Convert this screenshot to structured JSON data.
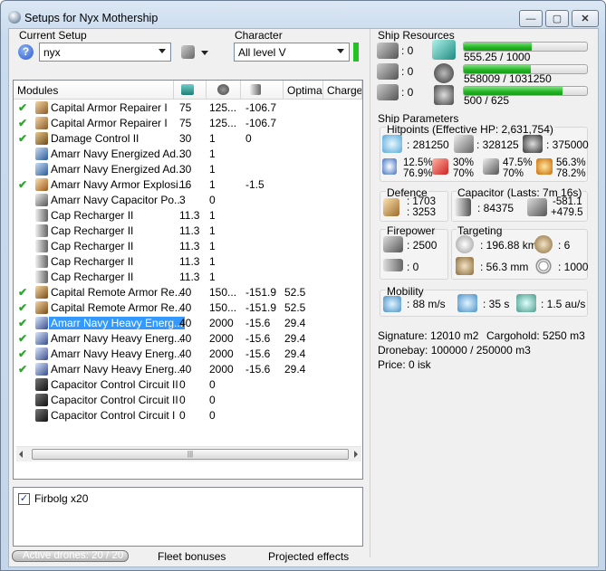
{
  "window": {
    "title": "Setups for Nyx Mothership"
  },
  "setup": {
    "label": "Current Setup",
    "value": "nyx"
  },
  "character": {
    "label": "Character",
    "value": "All level V"
  },
  "modules": {
    "headers": [
      "Modules",
      "",
      "",
      "",
      "Optimal",
      "Charges"
    ],
    "rows": [
      {
        "checked": true,
        "name": "Capital Armor Repairer I",
        "c1": "75",
        "c2": "125...",
        "c3": "-106.7",
        "opt": "",
        "icon": "armor-repairer-icon"
      },
      {
        "checked": true,
        "name": "Capital Armor Repairer I",
        "c1": "75",
        "c2": "125...",
        "c3": "-106.7",
        "opt": "",
        "icon": "armor-repairer-icon"
      },
      {
        "checked": true,
        "name": "Damage Control II",
        "c1": "30",
        "c2": "1",
        "c3": "0",
        "opt": "",
        "icon": "damage-control-icon"
      },
      {
        "checked": false,
        "name": "Amarr Navy Energized Ad...",
        "c1": "30",
        "c2": "1",
        "c3": "",
        "opt": "",
        "icon": "energized-plating-icon"
      },
      {
        "checked": false,
        "name": "Amarr Navy Energized Ad...",
        "c1": "30",
        "c2": "1",
        "c3": "",
        "opt": "",
        "icon": "energized-plating-icon"
      },
      {
        "checked": true,
        "name": "Amarr Navy Armor Explosi...",
        "c1": "16",
        "c2": "1",
        "c3": "-1.5",
        "opt": "",
        "icon": "armor-hardener-icon"
      },
      {
        "checked": false,
        "name": "Amarr Navy Capacitor Po...",
        "c1": "3",
        "c2": "0",
        "c3": "",
        "opt": "",
        "icon": "capacitor-power-relay-icon"
      },
      {
        "checked": false,
        "name": "Cap Recharger II",
        "c1": "11.3",
        "c2": "1",
        "c3": "",
        "opt": "",
        "icon": "cap-recharger-icon"
      },
      {
        "checked": false,
        "name": "Cap Recharger II",
        "c1": "11.3",
        "c2": "1",
        "c3": "",
        "opt": "",
        "icon": "cap-recharger-icon"
      },
      {
        "checked": false,
        "name": "Cap Recharger II",
        "c1": "11.3",
        "c2": "1",
        "c3": "",
        "opt": "",
        "icon": "cap-recharger-icon"
      },
      {
        "checked": false,
        "name": "Cap Recharger II",
        "c1": "11.3",
        "c2": "1",
        "c3": "",
        "opt": "",
        "icon": "cap-recharger-icon"
      },
      {
        "checked": false,
        "name": "Cap Recharger II",
        "c1": "11.3",
        "c2": "1",
        "c3": "",
        "opt": "",
        "icon": "cap-recharger-icon"
      },
      {
        "checked": true,
        "name": "Capital Remote Armor Re...",
        "c1": "40",
        "c2": "150...",
        "c3": "-151.9",
        "opt": "52.5",
        "icon": "remote-armor-repairer-icon"
      },
      {
        "checked": true,
        "name": "Capital Remote Armor Re...",
        "c1": "40",
        "c2": "150...",
        "c3": "-151.9",
        "opt": "52.5",
        "icon": "remote-armor-repairer-icon"
      },
      {
        "checked": true,
        "name": "Amarr Navy Heavy Energ...",
        "c1": "40",
        "c2": "2000",
        "c3": "-15.6",
        "opt": "29.4",
        "icon": "energy-neutralizer-icon",
        "selected": true
      },
      {
        "checked": true,
        "name": "Amarr Navy Heavy Energ...",
        "c1": "40",
        "c2": "2000",
        "c3": "-15.6",
        "opt": "29.4",
        "icon": "energy-neutralizer-icon"
      },
      {
        "checked": true,
        "name": "Amarr Navy Heavy Energ...",
        "c1": "40",
        "c2": "2000",
        "c3": "-15.6",
        "opt": "29.4",
        "icon": "energy-neutralizer-icon"
      },
      {
        "checked": true,
        "name": "Amarr Navy Heavy Energ...",
        "c1": "40",
        "c2": "2000",
        "c3": "-15.6",
        "opt": "29.4",
        "icon": "energy-neutralizer-icon"
      },
      {
        "checked": false,
        "name": "Capacitor Control Circuit II",
        "c1": "0",
        "c2": "0",
        "c3": "",
        "opt": "",
        "icon": "rig-icon"
      },
      {
        "checked": false,
        "name": "Capacitor Control Circuit II",
        "c1": "0",
        "c2": "0",
        "c3": "",
        "opt": "",
        "icon": "rig-icon"
      },
      {
        "checked": false,
        "name": "Capacitor Control Circuit I",
        "c1": "0",
        "c2": "0",
        "c3": "",
        "opt": "",
        "icon": "rig-icon"
      }
    ]
  },
  "drones": {
    "item": "Firbolg x20",
    "checked": true
  },
  "bottom_tabs": {
    "active_drones": "Active drones: 20 / 20",
    "fleet": "Fleet bonuses",
    "projected": "Projected effects"
  },
  "resources": {
    "label": "Ship Resources",
    "slots": [
      ": 0",
      ": 0",
      ": 0"
    ],
    "cpu": {
      "text": "555.25 / 1000",
      "fraction": 0.555
    },
    "power": {
      "text": "558009 / 1031250",
      "fraction": 0.541
    },
    "drone_bw": {
      "text": "500 / 625",
      "fraction": 0.8
    }
  },
  "params": {
    "label": "Ship Parameters",
    "hitpoints_label": "Hitpoints (Effective HP: 2,631,754)",
    "hp_shield": ": 281250",
    "hp_armor": ": 328125",
    "hp_structure": ": 375000",
    "res": [
      {
        "a": "12.5%",
        "b": "76.9%"
      },
      {
        "a": "30%",
        "b": "70%"
      },
      {
        "a": "47.5%",
        "b": "70%"
      },
      {
        "a": "56.3%",
        "b": "78.2%"
      }
    ],
    "defence_label": "Defence",
    "defence_a": ": 1703",
    "defence_b": ": 3253",
    "capacitor_label": "Capacitor (Lasts: 7m 16s)",
    "cap_amount": ": 84375",
    "cap_a": "-581.1",
    "cap_b": "+479.5",
    "firepower_label": "Firepower",
    "fp_a": ": 2500",
    "fp_b": ": 0",
    "targeting_label": "Targeting",
    "range": ": 196.88 km",
    "targets": ": 6",
    "scan": ": 56.3 mm",
    "sig_res": ": 1000",
    "mobility_label": "Mobility",
    "speed": ": 88 m/s",
    "align": ": 35 s",
    "warp": ": 1.5 au/s"
  },
  "info": {
    "signature": "Signature: 12010 m2",
    "cargohold": "Cargohold: 5250 m3",
    "dronebay": "Dronebay: 100000 / 250000 m3",
    "price": "Price: 0 isk"
  }
}
